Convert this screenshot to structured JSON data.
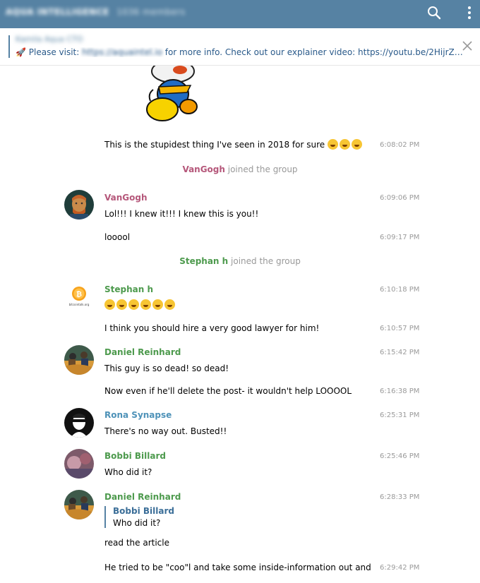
{
  "header": {
    "title": "AQUA INTELLIGENCE",
    "members": "1036 members",
    "search_icon": "search-icon",
    "menu_icon": "more-vertical-icon"
  },
  "pinned": {
    "author": "Kamila Aqua CTO",
    "prefix": "🚀 Please visit: ",
    "url": "https://aquaintel.io",
    "rest": " for more info. Check out our explainer video: https://youtu.be/2HijrZ87...",
    "close_icon": "close-icon"
  },
  "messages": {
    "m1": {
      "text": "This is the stupidest thing I've seen in 2018 for sure",
      "emojis": "3",
      "time": "6:08:02 PM"
    },
    "s1": {
      "name": "VanGogh",
      "action": " joined the group"
    },
    "m2": {
      "name": "VanGogh",
      "text": "Lol!!! I knew it!!! I knew this is you!!",
      "time": "6:09:06 PM"
    },
    "m3": {
      "text": "looool",
      "time": "6:09:17 PM"
    },
    "s2": {
      "name": "Stephan h",
      "action": " joined the group"
    },
    "m4": {
      "name": "Stephan h",
      "time": "6:10:18 PM"
    },
    "m5": {
      "text": "I think you should hire a very good lawyer for him!",
      "time": "6:10:57 PM"
    },
    "m6": {
      "name": "Daniel Reinhard",
      "text": "This guy is so dead! so dead!",
      "time": "6:15:42 PM"
    },
    "m7": {
      "text": "Now even if he'll delete the post- it wouldn't help LOOOOL",
      "time": "6:16:38 PM"
    },
    "m8": {
      "name": "Rona Synapse",
      "text": "There's no way out. Busted!!",
      "time": "6:25:31 PM"
    },
    "m9": {
      "name": "Bobbi Billard",
      "text": "Who did it?",
      "time": "6:25:46 PM"
    },
    "m10": {
      "name": "Daniel Reinhard",
      "reply_name": "Bobbi Billard",
      "reply_text": "Who did it?",
      "text": "read the article",
      "time": "6:28:33 PM"
    },
    "m11": {
      "text": "He tried to be \"coo\"l and take some inside-information out and",
      "time": "6:29:42 PM"
    }
  },
  "avatars": {
    "vangogh": "vangogh-portrait-avatar",
    "stephan": "bitcoin-logo-avatar",
    "stephan_caption": "bitcointalk.org",
    "daniel": "painting-avatar",
    "rona": "anonymous-mask-avatar",
    "bobbi": "photo-avatar"
  },
  "colors": {
    "header": "#5682a3",
    "vangogh": "#b5577a",
    "green_name": "#4d9a4d",
    "blue_name": "#4e92b8"
  }
}
